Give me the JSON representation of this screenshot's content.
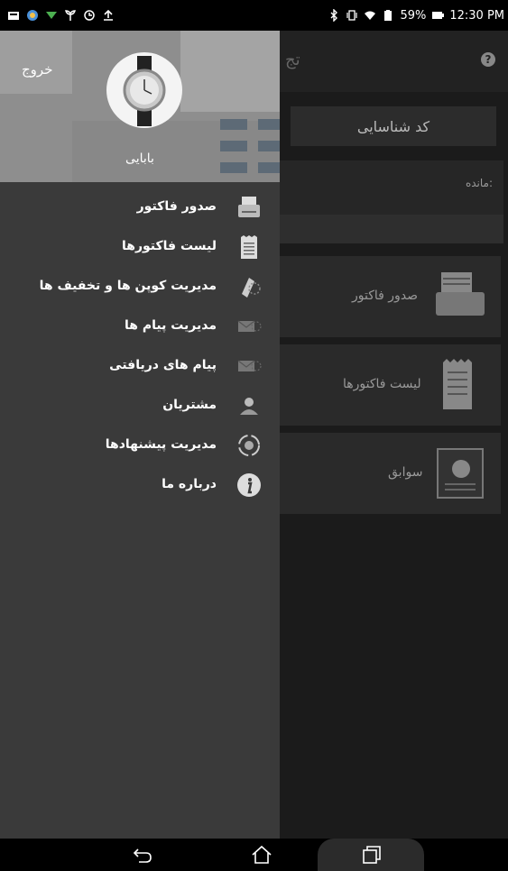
{
  "status_bar": {
    "battery": "59%",
    "time": "12:30 PM",
    "left_icons": [
      "notification-icon",
      "app-icon",
      "signal-down-icon",
      "plant-icon",
      "sync-icon",
      "upload-icon"
    ],
    "right_icons": [
      "bluetooth-icon",
      "vibrate-icon",
      "wifi-icon",
      "battery-saver-icon",
      "battery-icon"
    ]
  },
  "app": {
    "title": "تج",
    "code_button": "کد شناسایی",
    "balance_label": "مانده:",
    "tiles": [
      {
        "label": "صدور فاکتور",
        "icon": "printer-icon"
      },
      {
        "label": "لیست فاکتورها",
        "icon": "receipt-icon"
      },
      {
        "label": "سوابق",
        "icon": "history-icon"
      }
    ]
  },
  "drawer": {
    "logout": "خروج",
    "username": "بابایی",
    "menu": [
      {
        "label": "صدور فاکتور",
        "icon": "printer-icon"
      },
      {
        "label": "لیست فاکتورها",
        "icon": "invoice-list-icon"
      },
      {
        "label": "مدیریت کوپن ها و تخفیف ها",
        "icon": "coupon-icon"
      },
      {
        "label": "مدیریت پیام ها",
        "icon": "message-icon"
      },
      {
        "label": "پیام های دریافتی",
        "icon": "inbox-icon"
      },
      {
        "label": "مشتریان",
        "icon": "customers-icon"
      },
      {
        "label": "مدیریت پیشنهادها",
        "icon": "offers-icon"
      },
      {
        "label": "درباره ما",
        "icon": "info-icon"
      }
    ]
  },
  "colors": {
    "drawer_bg": "#3a3a3a",
    "header_bg": "#8e8e8e",
    "app_bg": "#1b1b1b"
  }
}
